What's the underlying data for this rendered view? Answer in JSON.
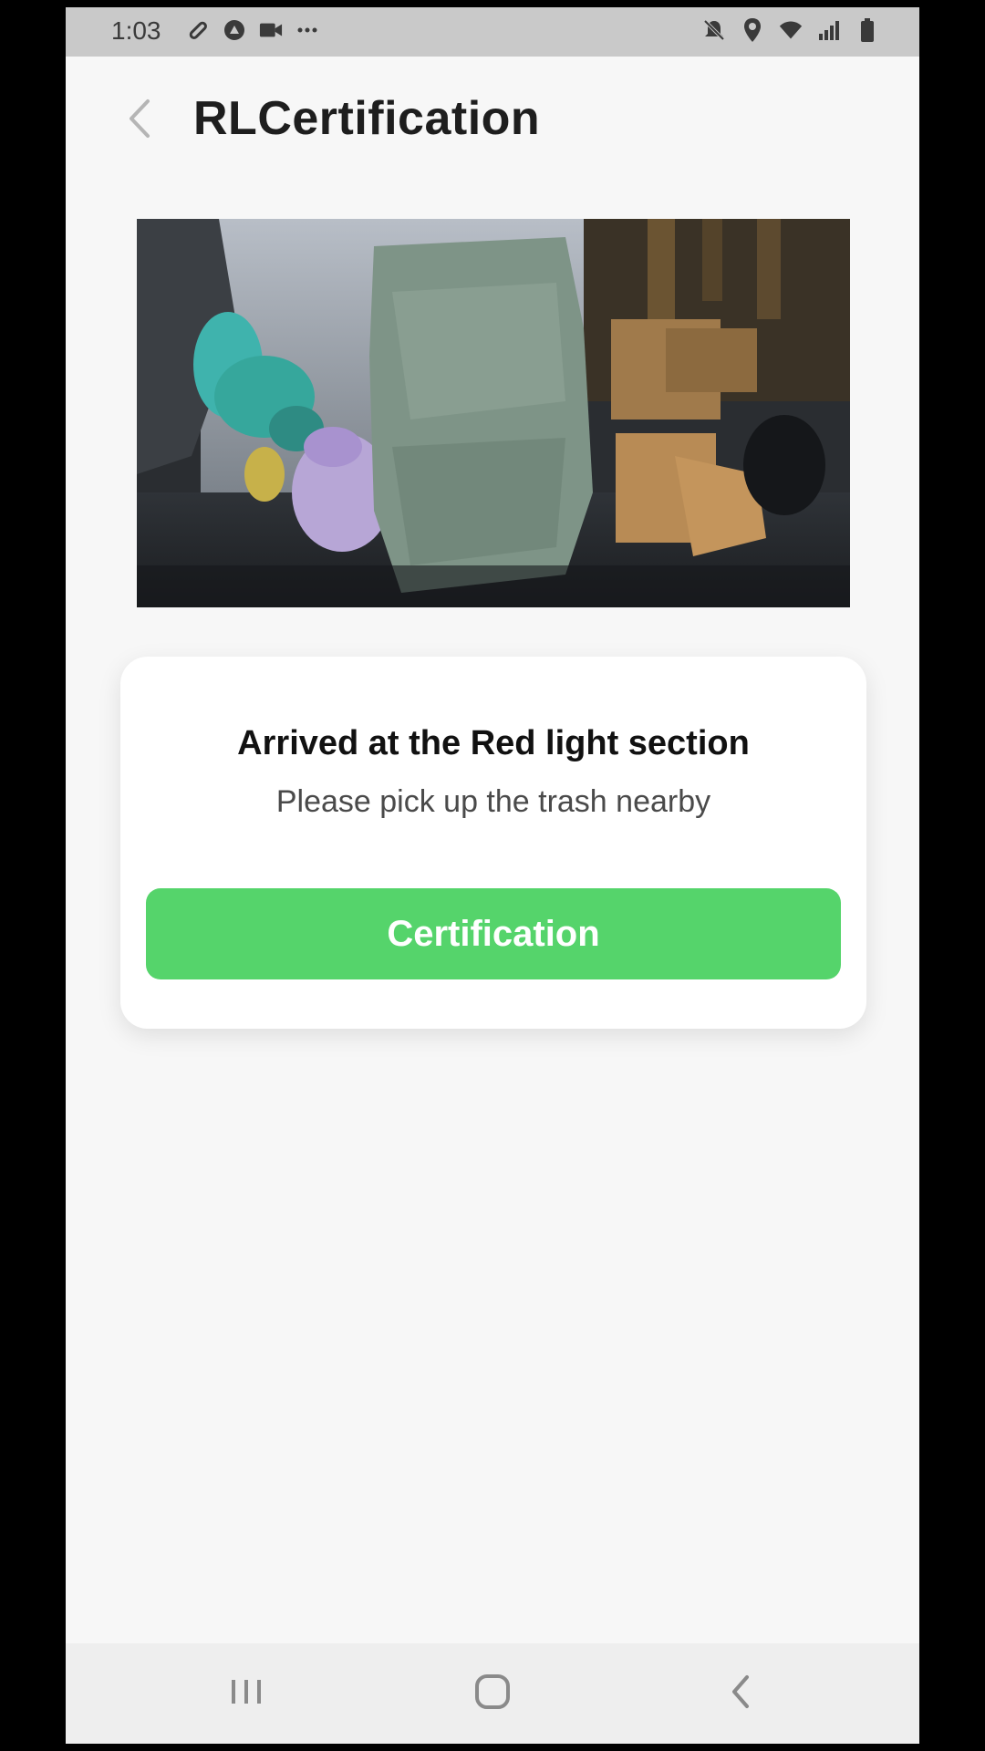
{
  "status_bar": {
    "time": "1:03",
    "left_icons": [
      "link-icon",
      "vpn-icon",
      "video-camera-icon",
      "more-dots-icon"
    ],
    "right_icons": [
      "mute-icon",
      "location-icon",
      "wifi-icon",
      "signal-icon",
      "battery-icon"
    ]
  },
  "header": {
    "title": "RLCertification",
    "back_icon": "chevron-left-icon"
  },
  "photo": {
    "description_icon": "trash-photo"
  },
  "card": {
    "title": "Arrived at the Red light section",
    "subtitle": "Please pick up the trash nearby",
    "button_label": "Certification"
  },
  "nav_bar": {
    "recents_icon": "recents-icon",
    "home_icon": "home-icon",
    "back_icon": "back-icon"
  },
  "colors": {
    "accent": "#55d46b",
    "background": "#f7f7f7",
    "card": "#ffffff",
    "title_text": "#1e1e1e"
  }
}
